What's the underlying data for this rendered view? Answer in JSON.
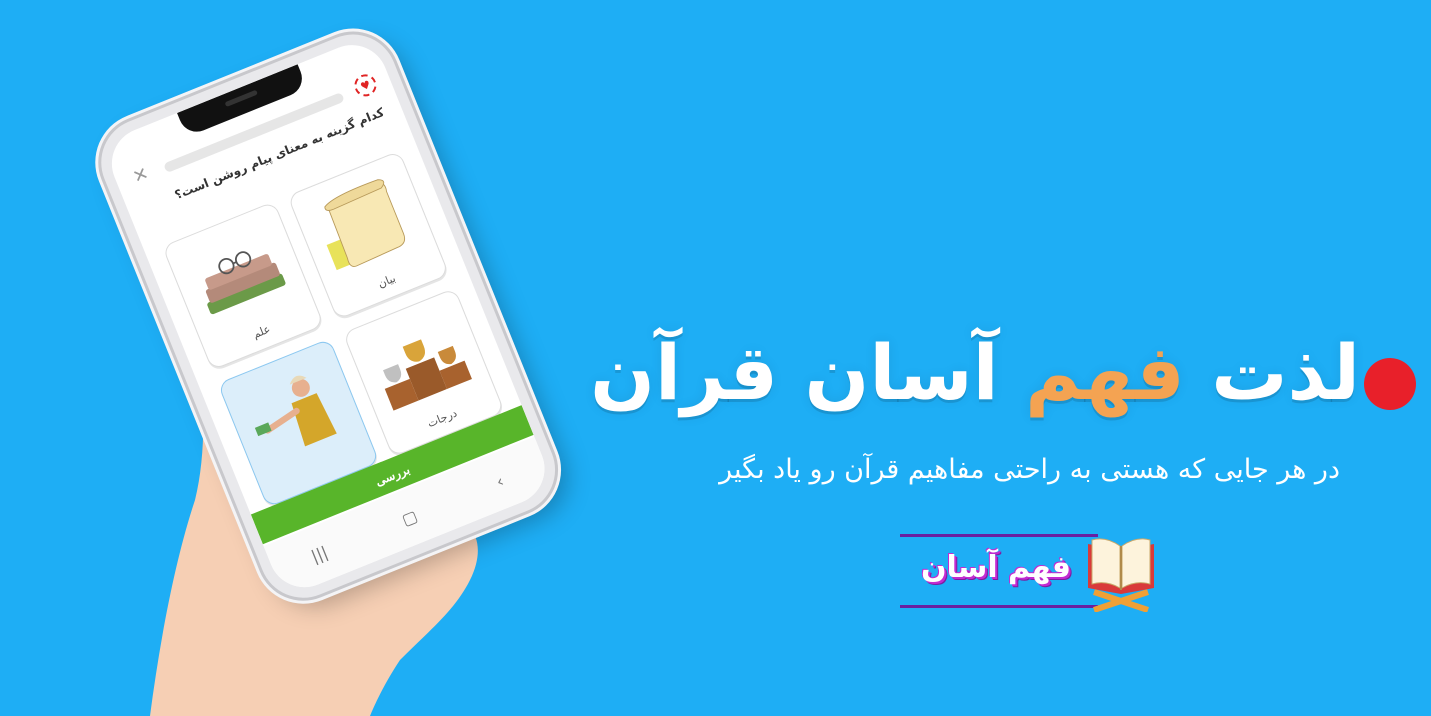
{
  "quiz": {
    "question": "کدام گزینه به معنای پیام روشن است؟",
    "options": [
      {
        "label": "بیان",
        "icon": "scroll-icon",
        "selected": false
      },
      {
        "label": "علم",
        "icon": "books-glasses-icon",
        "selected": false
      },
      {
        "label": "درجات",
        "icon": "trophy-podium-icon",
        "selected": false
      },
      {
        "label": "",
        "icon": "giving-money-icon",
        "selected": true
      }
    ],
    "check_label": "بررسی",
    "close_icon": "close-icon",
    "lives_icon": "heart-icon"
  },
  "navbar": {
    "back_icon": "chevron-back-icon",
    "home_icon": "home-square-icon",
    "recent_icon": "recent-apps-icon"
  },
  "promo": {
    "headline_part1": "لذت",
    "headline_accent": "فهم",
    "headline_part2": "آسان قرآن",
    "subheadline": "در هر جایی که هستی به راحتی مفاهیم قرآن رو یاد بگیر",
    "logo_text": "فهم آسان"
  },
  "colors": {
    "background": "#1eaef5",
    "accent": "#f4a352",
    "dot": "#e8202a",
    "button": "#58b52a",
    "logo_purple": "#6a1fa0"
  }
}
